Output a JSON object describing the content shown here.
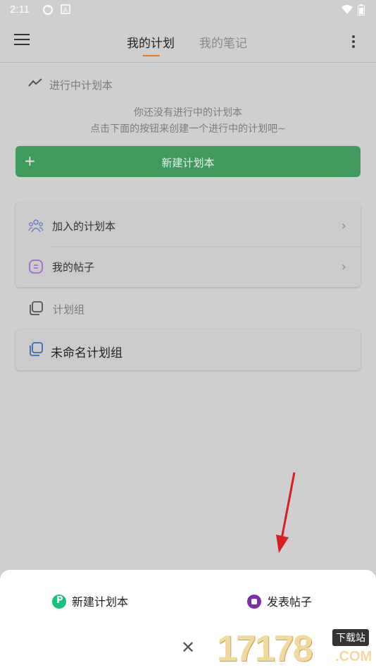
{
  "status_bar": {
    "time": "2:11",
    "icons": [
      "sync-icon",
      "a-badge-icon",
      "wifi-icon",
      "battery-icon"
    ]
  },
  "header": {
    "tabs": [
      {
        "label": "我的计划",
        "active": true
      },
      {
        "label": "我的笔记",
        "active": false
      }
    ],
    "icons": {
      "menu": "menu-icon",
      "more": "more-vertical-icon"
    },
    "accent": "#e07a2a"
  },
  "in_progress": {
    "title": "进行中计划本",
    "empty_line1": "你还没有进行中的计划本",
    "empty_line2": "点击下面的按钮来创建一个进行中的计划吧~",
    "button_label": "新建计划本",
    "button_color": "#3f9a5d"
  },
  "links": [
    {
      "label": "加入的计划本",
      "icon": "people-icon",
      "icon_color": "#6d7fc9"
    },
    {
      "label": "我的帖子",
      "icon": "chat-icon",
      "icon_color": "#9b6cd1"
    }
  ],
  "groups": {
    "title": "计划组",
    "items": [
      {
        "label": "未命名计划组",
        "icon": "copy-icon"
      }
    ]
  },
  "sheet": {
    "actions": [
      {
        "label": "新建计划本",
        "icon": "p-circle-icon",
        "color": "#17c27a"
      },
      {
        "label": "发表帖子",
        "icon": "post-circle-icon",
        "color": "#7b2fa6"
      }
    ],
    "close_icon": "close-icon"
  },
  "watermark": {
    "text": "17178",
    "badge": "下载站",
    "suffix": ".COM"
  }
}
